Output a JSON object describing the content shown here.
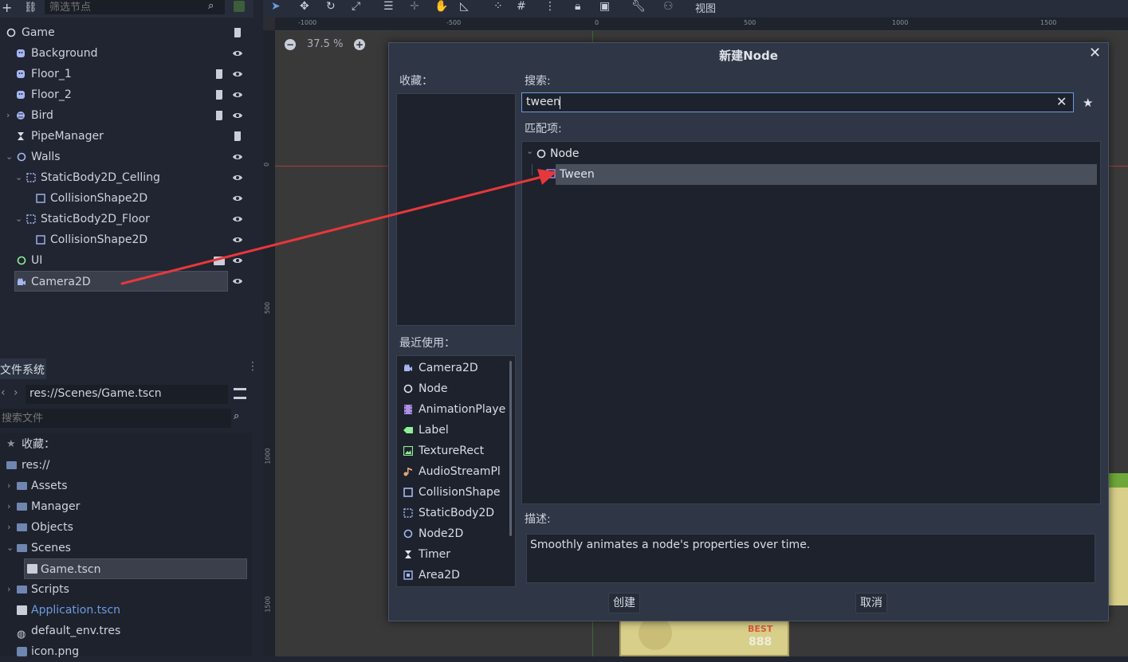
{
  "scene_dock": {
    "filter_placeholder": "筛选节点",
    "tree": [
      {
        "label": "Game"
      },
      {
        "label": "Background"
      },
      {
        "label": "Floor_1"
      },
      {
        "label": "Floor_2"
      },
      {
        "label": "Bird"
      },
      {
        "label": "PipeManager"
      },
      {
        "label": "Walls"
      },
      {
        "label": "StaticBody2D_Celling"
      },
      {
        "label": "CollisionShape2D"
      },
      {
        "label": "StaticBody2D_Floor"
      },
      {
        "label": "CollisionShape2D"
      },
      {
        "label": "UI"
      },
      {
        "label": "Camera2D"
      }
    ]
  },
  "filesystem": {
    "tab": "文件系统",
    "path": "res://Scenes/Game.tscn",
    "search_placeholder": "搜索文件",
    "items": [
      {
        "label": "收藏："
      },
      {
        "label": "res://"
      },
      {
        "label": "Assets"
      },
      {
        "label": "Manager"
      },
      {
        "label": "Objects"
      },
      {
        "label": "Scenes"
      },
      {
        "label": "Game.tscn"
      },
      {
        "label": "Scripts"
      },
      {
        "label": "Application.tscn"
      },
      {
        "label": "default_env.tres"
      },
      {
        "label": "icon.png"
      }
    ]
  },
  "viewport": {
    "zoom": "37.5 %",
    "view_menu": "视图",
    "ruler_h": [
      "-1000",
      "-500",
      "0",
      "500",
      "1000",
      "1500"
    ],
    "ruler_v": [
      "0",
      "500",
      "1000",
      "1500"
    ],
    "game_text": "BEST",
    "game_score": "888"
  },
  "dialog": {
    "title": "新建Node",
    "favorites_label": "收藏：",
    "search_label": "搜索:",
    "search_value": "tween",
    "matches_label": "匹配项:",
    "matches": [
      {
        "label": "Node"
      },
      {
        "label": "Tween"
      }
    ],
    "recent_label": "最近使用：",
    "recent": [
      {
        "label": "Camera2D"
      },
      {
        "label": "Node"
      },
      {
        "label": "AnimationPlaye"
      },
      {
        "label": "Label"
      },
      {
        "label": "TextureRect"
      },
      {
        "label": "AudioStreamPl"
      },
      {
        "label": "CollisionShape"
      },
      {
        "label": "StaticBody2D"
      },
      {
        "label": "Node2D"
      },
      {
        "label": "Timer"
      },
      {
        "label": "Area2D"
      }
    ],
    "description_label": "描述:",
    "description": "Smoothly animates a node's properties over time.",
    "create_button": "创建",
    "cancel_button": "取消"
  },
  "colors": {
    "accent": "#4a90d9",
    "annotation_arrow": "#e8373b",
    "selected_row": "#4a4f5c",
    "tween_icon": "#b08ee8"
  }
}
